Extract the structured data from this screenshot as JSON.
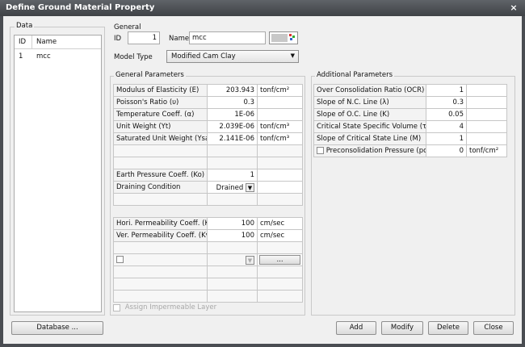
{
  "window": {
    "title": "Define Ground Material Property",
    "close_glyph": "×"
  },
  "data_panel": {
    "group_label": "Data",
    "columns": [
      "ID",
      "Name"
    ],
    "rows": [
      {
        "id": "1",
        "name": "mcc"
      }
    ]
  },
  "general": {
    "group_label": "General",
    "id_label": "ID",
    "id_value": "1",
    "name_label": "Name",
    "name_value": "mcc",
    "model_type_label": "Model Type",
    "model_type_value": "Modified Cam Clay"
  },
  "general_params": {
    "group_label": "General Parameters",
    "rows": [
      {
        "label": "Modulus of Elasticity (E)",
        "value": "203.943",
        "unit": "tonf/cm²"
      },
      {
        "label": "Poisson's Ratio (υ)",
        "value": "0.3",
        "unit": ""
      },
      {
        "label": "Temperature Coeff. (α)",
        "value": "1E-06",
        "unit": ""
      },
      {
        "label": "Unit Weight (Yt)",
        "value": "2.039E-06",
        "unit": "tonf/cm³"
      },
      {
        "label": "Saturated Unit Weight (Ysat)",
        "value": "2.141E-06",
        "unit": "tonf/cm³"
      }
    ],
    "ko_label": "Earth Pressure Coeff. (Ko)",
    "ko_value": "1",
    "drain_label": "Draining Condition",
    "drain_value": "Drained",
    "drain_arrow": "▼"
  },
  "permeability": {
    "rows": [
      {
        "label": "Hori. Permeability Coeff. (Kh)",
        "value": "100",
        "unit": "cm/sec"
      },
      {
        "label": "Ver. Permeability Coeff. (Kv)",
        "value": "100",
        "unit": "cm/sec"
      }
    ],
    "dots_label": "...",
    "arrow": "▼",
    "impermeable_label": "Assign Impermeable Layer"
  },
  "additional_params": {
    "group_label": "Additional Parameters",
    "rows": [
      {
        "label": "Over Consolidation Ratio (OCR)",
        "value": "1",
        "unit": ""
      },
      {
        "label": "Slope of N.C. Line (λ)",
        "value": "0.3",
        "unit": ""
      },
      {
        "label": "Slope of O.C. Line (K)",
        "value": "0.05",
        "unit": ""
      },
      {
        "label": "Critical State Specific Volume (τ)",
        "value": "4",
        "unit": ""
      },
      {
        "label": "Slope of Critical State Line (M)",
        "value": "1",
        "unit": ""
      }
    ],
    "pc_label": "Preconsolidation Pressure (pc)",
    "pc_value": "0",
    "pc_unit": "tonf/cm²"
  },
  "buttons": {
    "database": "Database ...",
    "add": "Add",
    "modify": "Modify",
    "delete": "Delete",
    "close": "Close"
  },
  "colors": {
    "titlebar": "#4a4d52",
    "dialog_bg": "#f0f0f0",
    "border": "#c6c6c6"
  }
}
